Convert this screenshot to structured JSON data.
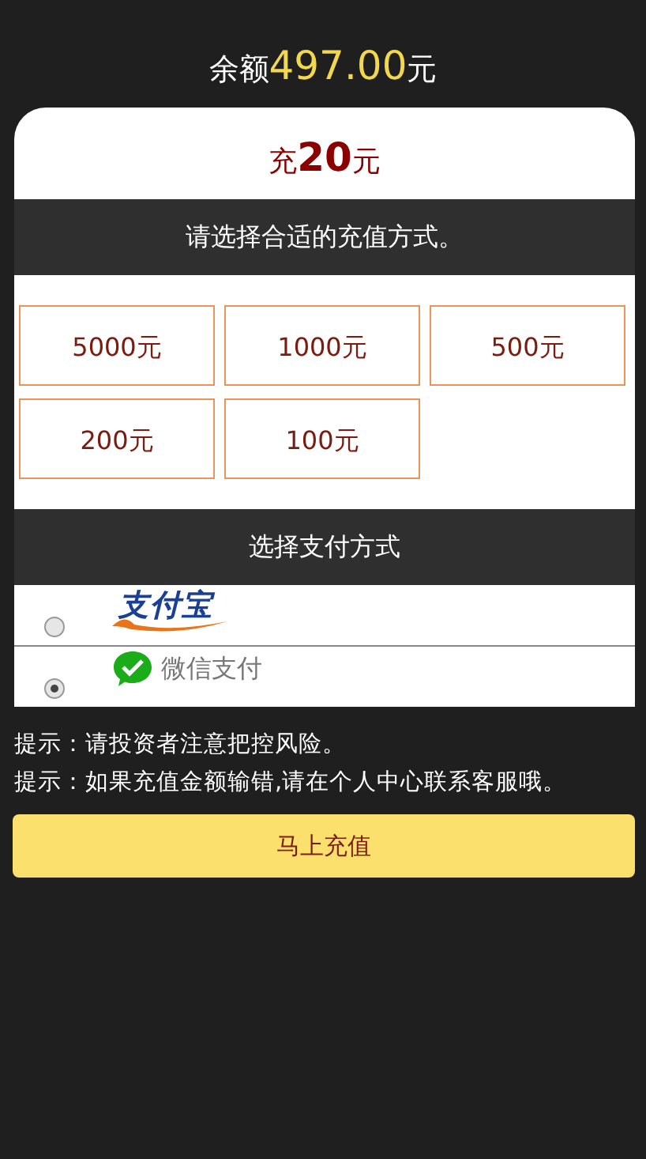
{
  "balance": {
    "label": "余额",
    "amount": "497.00",
    "unit": "元"
  },
  "charge": {
    "prefix": "充",
    "amount": "20",
    "unit": "元"
  },
  "amount_section": {
    "title": "请选择合适的充值方式。"
  },
  "amounts": [
    {
      "label": "5000元"
    },
    {
      "label": "1000元"
    },
    {
      "label": "500元"
    },
    {
      "label": "200元"
    },
    {
      "label": "100元"
    }
  ],
  "payment_section": {
    "title": "选择支付方式"
  },
  "payment_methods": [
    {
      "kind": "alipay",
      "label": "支付宝",
      "selected": false
    },
    {
      "kind": "wechat",
      "label": "微信支付",
      "selected": true
    }
  ],
  "tips": [
    "提示：请投资者注意把控风险。",
    "提示：如果充值金额输错,请在个人中心联系客服哦。"
  ],
  "submit_button": "马上充值"
}
